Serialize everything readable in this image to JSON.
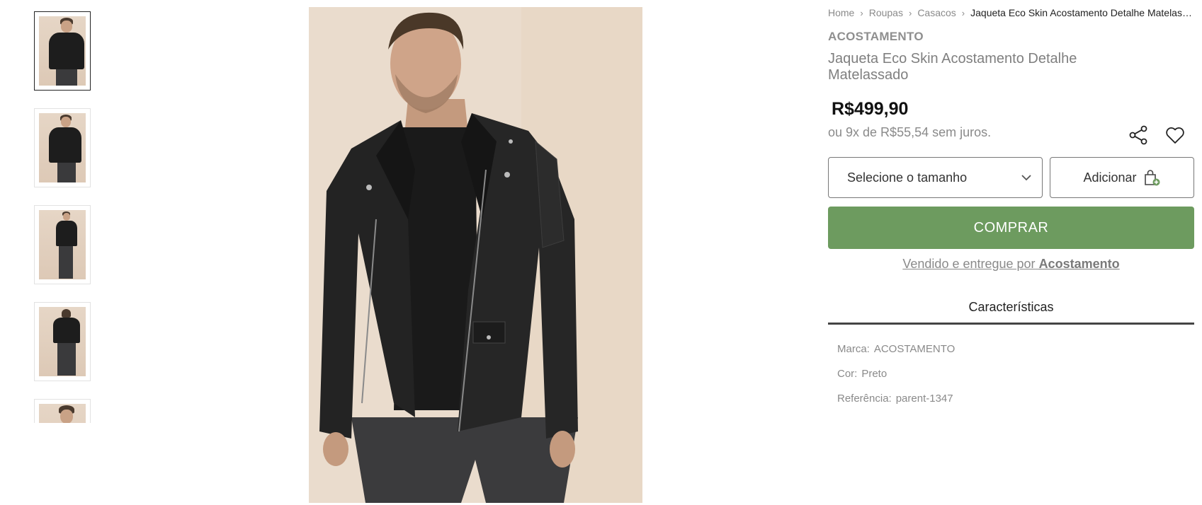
{
  "breadcrumb": {
    "items": [
      "Home",
      "Roupas",
      "Casacos"
    ],
    "current": "Jaqueta Eco Skin Acostamento Detalhe Matelassado"
  },
  "product": {
    "brand": "ACOSTAMENTO",
    "title": "Jaqueta Eco Skin Acostamento Detalhe Matelassado",
    "price": "R$499,90",
    "installments": "ou 9x de R$55,54 sem juros."
  },
  "actions": {
    "size_placeholder": "Selecione o tamanho",
    "add_label": "Adicionar",
    "buy_label": "COMPRAR"
  },
  "seller": {
    "prefix": "Vendido e entregue por",
    "name": "Acostamento"
  },
  "tabs": {
    "characteristics": "Características"
  },
  "specs": [
    {
      "key": "Marca:",
      "value": "ACOSTAMENTO"
    },
    {
      "key": "Cor:",
      "value": "Preto"
    },
    {
      "key": "Referência:",
      "value": "parent-1347"
    }
  ],
  "icons": {
    "share": "share-icon",
    "favorite": "heart-icon",
    "chevron": "chevron-down-icon",
    "bag": "shopping-bag-add-icon"
  },
  "colors": {
    "buy_button": "#6d9b5f",
    "text_muted": "#8a8a8a",
    "tab_underline": "#444444"
  }
}
